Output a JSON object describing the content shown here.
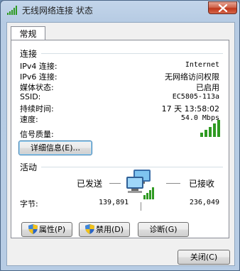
{
  "window": {
    "title": "无线网络连接 状态"
  },
  "tab": {
    "label": "常规"
  },
  "connection": {
    "section_title": "连接",
    "rows": [
      {
        "label": "IPv4 连接:",
        "value": "Internet"
      },
      {
        "label": "IPv6 连接:",
        "value": "无网络访问权限"
      },
      {
        "label": "媒体状态:",
        "value": "已启用"
      },
      {
        "label": "SSID:",
        "value": "EC5805-113a"
      },
      {
        "label": "持续时间:",
        "value": "17 天 13:58:02"
      },
      {
        "label": "速度:",
        "value": "54.0 Mbps"
      }
    ],
    "signal_label": "信号质量:",
    "signal_bars": 5,
    "details_button": "详细信息(E)..."
  },
  "activity": {
    "section_title": "活动",
    "sent_label": "已发送",
    "received_label": "已接收",
    "bytes_label": "字节:",
    "bytes_sent": "139,891",
    "bytes_received": "236,049"
  },
  "buttons": {
    "properties": "属性(P)",
    "disable": "禁用(D)",
    "diagnose": "诊断(G)",
    "close": "关闭(C)"
  },
  "colors": {
    "signal_green": "#2f9a22",
    "shield_blue": "#2a64c6",
    "shield_yellow": "#f2c21a"
  }
}
